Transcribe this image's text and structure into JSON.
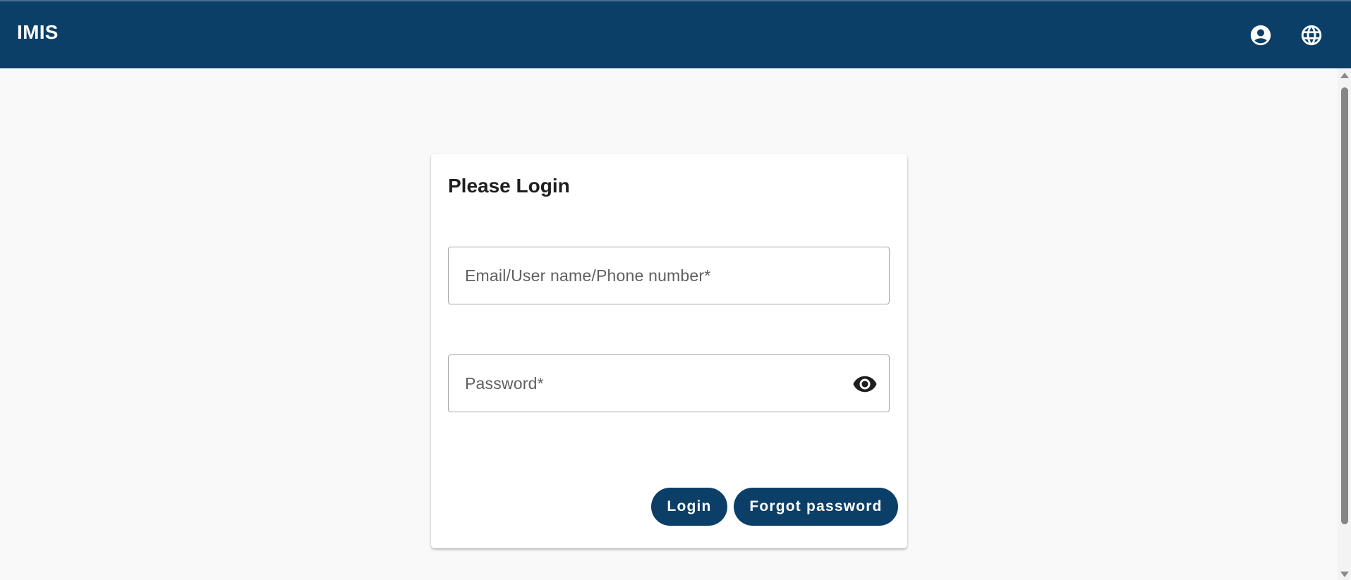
{
  "header": {
    "title": "IMIS",
    "icons": {
      "account": "account-circle-icon",
      "language": "globe-icon"
    }
  },
  "login": {
    "title": "Please Login",
    "username_placeholder": "Email/User name/Phone number*",
    "username_value": "",
    "password_placeholder": "Password*",
    "password_value": "",
    "password_toggle_icon": "eye-icon",
    "login_label": "Login",
    "forgot_label": "Forgot password"
  },
  "colors": {
    "primary": "#0b3f68",
    "background": "#f9f9f9",
    "card": "#ffffff"
  }
}
